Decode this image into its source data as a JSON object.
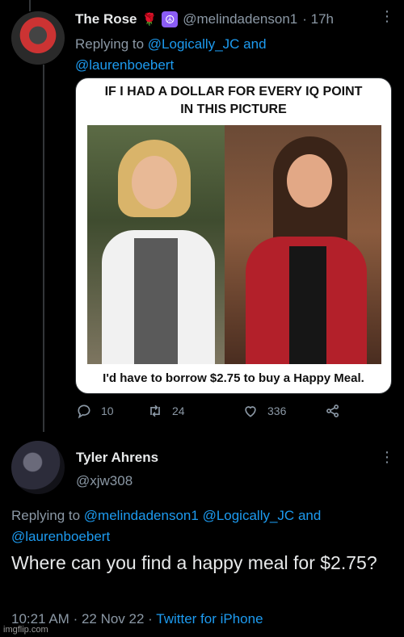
{
  "tweet1": {
    "display_name": "The Rose",
    "name_emoji": "🌹",
    "badge_emoji": "☮",
    "handle": "@melindadenson1",
    "time": "· 17h",
    "replying_prefix": "Replying to",
    "replying_to_1": "@Logically_JC",
    "replying_and": "and",
    "replying_to_2": "@laurenboebert",
    "meme": {
      "top_text_line1": "IF I HAD A DOLLAR FOR EVERY IQ POINT",
      "top_text_line2": "IN THIS PICTURE",
      "bottom_text": "I'd have to borrow $2.75 to buy a Happy Meal."
    },
    "replies": "10",
    "retweets": "24",
    "likes": "336",
    "more": "⋮"
  },
  "tweet2": {
    "display_name": "Tyler Ahrens",
    "handle": "@xjw308",
    "more": "⋮",
    "replying_prefix": "Replying to",
    "replying_to_1": "@melindadenson1",
    "replying_to_2": "@Logically_JC",
    "replying_and": "and",
    "replying_to_3": "@laurenboebert",
    "text": "Where can you find a happy meal for $2.75?",
    "time": "10:21 AM",
    "date": "· 22 Nov 22 ·",
    "source": "Twitter for iPhone"
  },
  "watermark": "imgflip.com",
  "colors": {
    "background": "#000000",
    "text": "#e7e9ea",
    "muted": "#8b98a5",
    "link": "#1d9bf0"
  }
}
